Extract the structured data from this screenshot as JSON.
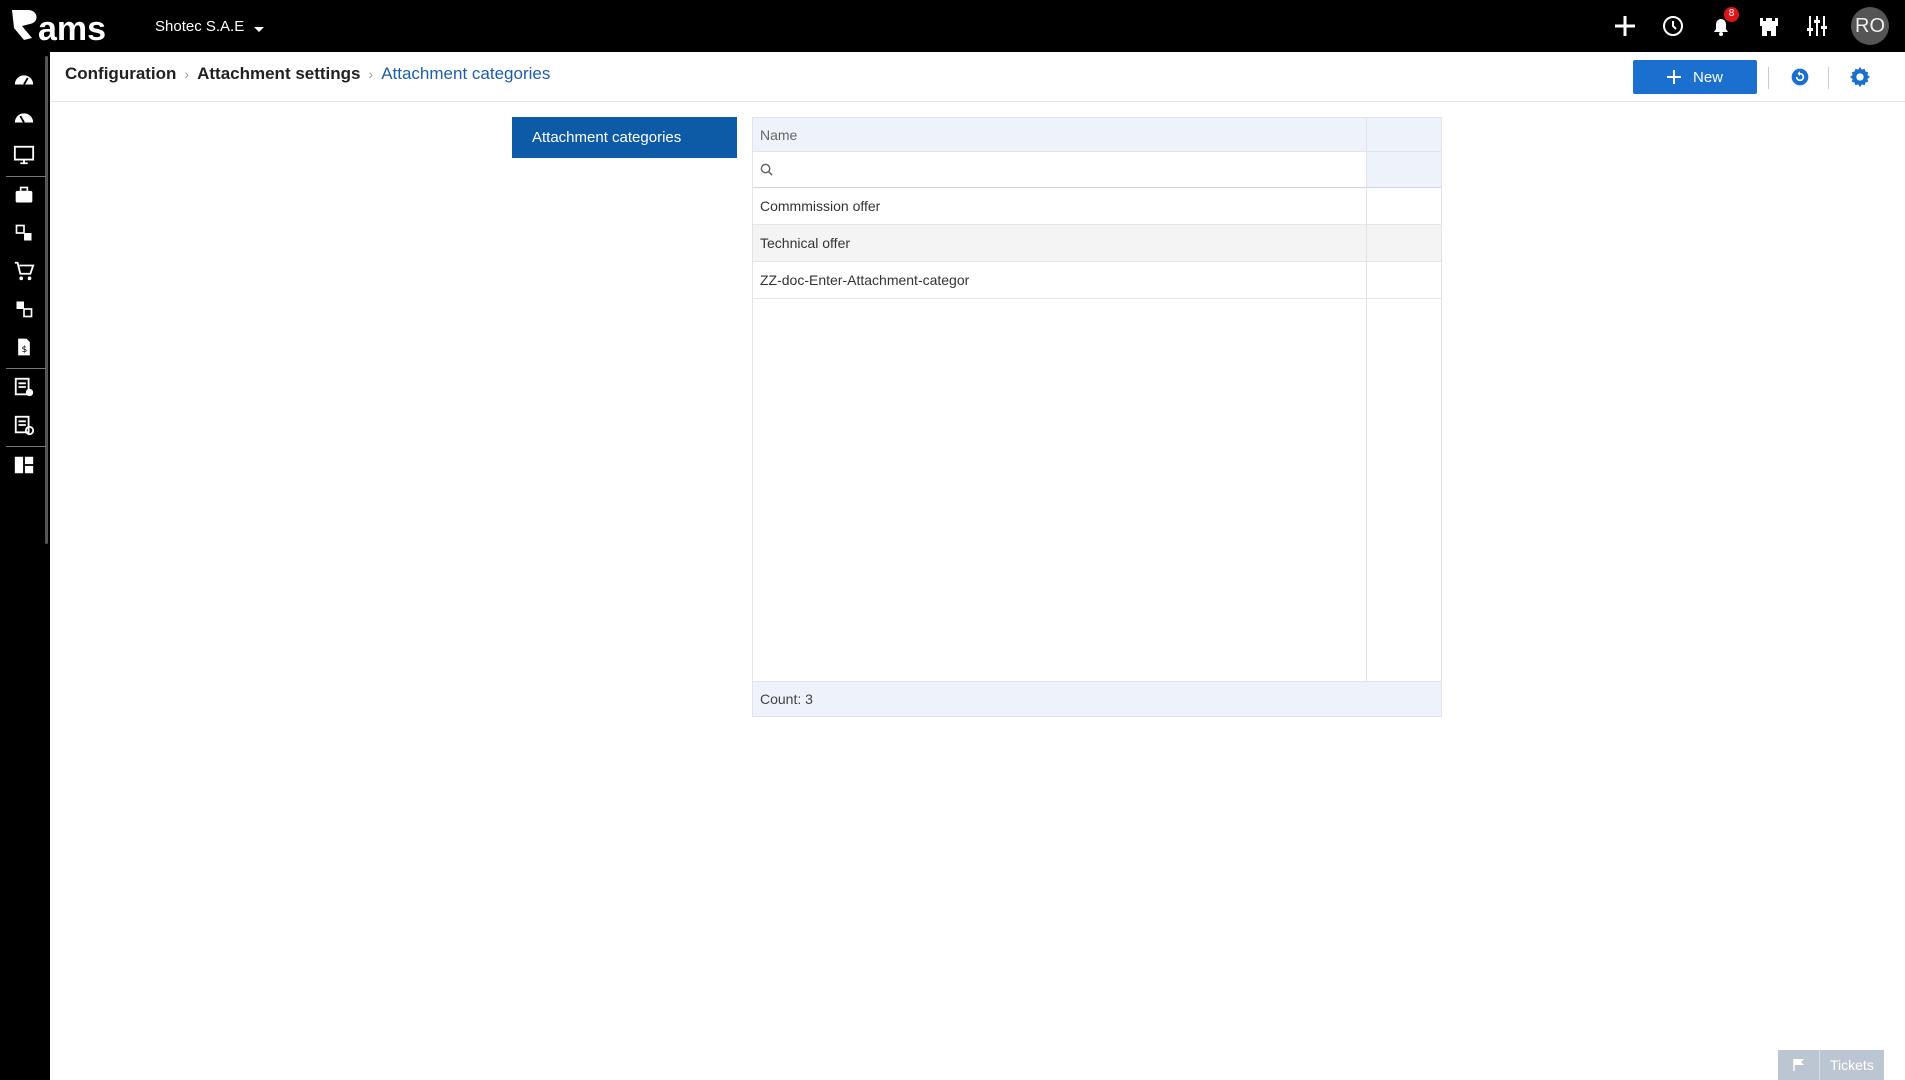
{
  "app": {
    "logo_text": "ams",
    "company": "Shotec S.A.E"
  },
  "topbar": {
    "notifications_count": "8",
    "user_initials": "RO"
  },
  "breadcrumb": {
    "items": [
      "Configuration",
      "Attachment settings"
    ],
    "current": "Attachment categories"
  },
  "header": {
    "new_label": "New"
  },
  "leftnav": {
    "active": "Attachment categories"
  },
  "grid": {
    "column_name": "Name",
    "filter_placeholder": "",
    "rows": [
      "Commmission offer",
      "Technical offer",
      "ZZ-doc-Enter-Attachment-categor"
    ],
    "footer": "Count: 3"
  },
  "tickets": {
    "label": "Tickets"
  },
  "colors": {
    "accent": "#1b6fcf",
    "nav_active": "#0d5aa7",
    "badge": "#e0151b"
  }
}
